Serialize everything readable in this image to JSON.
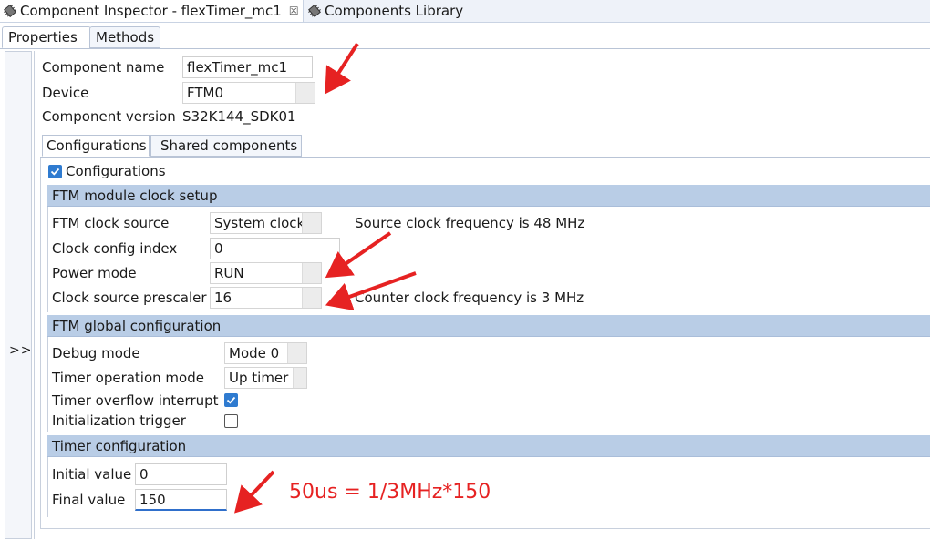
{
  "view_tabs": [
    {
      "label": "Component Inspector - flexTimer_mc1",
      "icon": "component-icon",
      "closable": true,
      "close_glyph": "☒"
    },
    {
      "label": "Components Library",
      "icon": "component-icon"
    }
  ],
  "sub_tabs": {
    "properties": "Properties",
    "methods": "Methods"
  },
  "collapse_label": ">>",
  "component": {
    "name_label": "Component name",
    "name_value": "flexTimer_mc1",
    "device_label": "Device",
    "device_value": "FTM0",
    "version_label": "Component version",
    "version_value": "S32K144_SDK01"
  },
  "config_tabs": {
    "configurations": "Configurations",
    "shared": "Shared components"
  },
  "configurations_checkbox": {
    "label": "Configurations",
    "checked": true
  },
  "clock_setup": {
    "header": "FTM module clock setup",
    "clock_source_label": "FTM clock source",
    "clock_source_value": "System clock",
    "clock_source_info": "Source clock frequency is 48 MHz",
    "config_index_label": "Clock config index",
    "config_index_value": "0",
    "power_mode_label": "Power mode",
    "power_mode_value": "RUN",
    "prescaler_label": "Clock source prescaler",
    "prescaler_value": "16",
    "prescaler_info": "Counter clock frequency is 3 MHz"
  },
  "global_config": {
    "header": "FTM global configuration",
    "debug_mode_label": "Debug mode",
    "debug_mode_value": "Mode 0",
    "timer_op_label": "Timer operation mode",
    "timer_op_value": "Up timer",
    "overflow_label": "Timer overflow interrupt",
    "overflow_checked": true,
    "init_trigger_label": "Initialization trigger",
    "init_trigger_checked": false
  },
  "timer_config": {
    "header": "Timer configuration",
    "initial_label": "Initial value",
    "initial_value": "0",
    "final_label": "Final value",
    "final_value": "150"
  },
  "annotation": {
    "note": "50us = 1/3MHz*150",
    "color": "#e62222"
  },
  "colors": {
    "section_header": "#b9cde6",
    "check_accent": "#2f7bd0",
    "focus_underline": "#2f6fcb"
  }
}
